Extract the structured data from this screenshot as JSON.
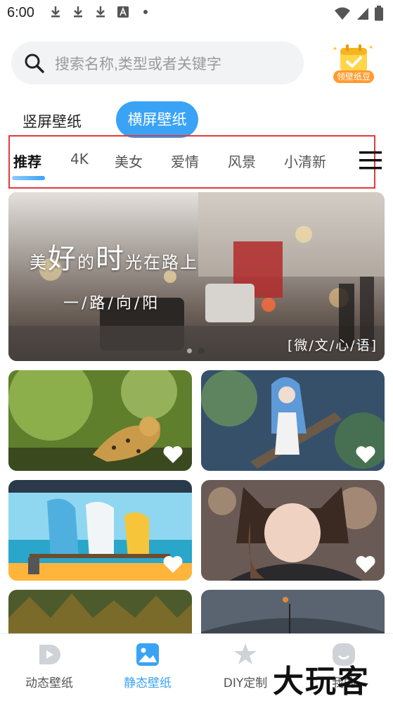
{
  "status_bar": {
    "time": "6:00"
  },
  "search": {
    "placeholder": "搜索名称,类型或者关键字"
  },
  "bean_badge": {
    "label": "领壁纸豆"
  },
  "orientation_tabs": {
    "portrait": "竖屏壁纸",
    "landscape": "横屏壁纸",
    "selected": "横屏壁纸"
  },
  "categories": {
    "items": [
      "推荐",
      "4K",
      "美女",
      "爱情",
      "风景",
      "小清新"
    ],
    "selected": "推荐"
  },
  "banner": {
    "title_parts": [
      "美",
      "好",
      "的",
      "时",
      "光在路上"
    ],
    "subtitle": "一/路/向/阳",
    "tag": "[微/文/心/语]",
    "page_count": 2,
    "current_page": 2
  },
  "wallpapers": [
    {
      "subject": "leopard",
      "icon": "heart-icon"
    },
    {
      "subject": "anime-girl-blue-hair",
      "icon": "heart-icon"
    },
    {
      "subject": "anime-girls-beach-bench",
      "icon": "heart-icon"
    },
    {
      "subject": "girl-cat-ears",
      "icon": "heart-icon"
    },
    {
      "subject": "forest",
      "icon": null
    },
    {
      "subject": "dark-landscape",
      "icon": null
    }
  ],
  "bottom_nav": {
    "items": [
      {
        "label": "动态壁纸",
        "icon": "play-d-icon"
      },
      {
        "label": "静态壁纸",
        "icon": "image-icon"
      },
      {
        "label": "DIY定制",
        "icon": "star-icon"
      },
      {
        "label": "我的",
        "icon": "smile-icon"
      }
    ],
    "selected": "静态壁纸"
  },
  "watermark": "大玩客",
  "colors": {
    "accent": "#3aa3f5",
    "highlight_box": "#e33a3a",
    "badge": "#ff9b2f"
  }
}
